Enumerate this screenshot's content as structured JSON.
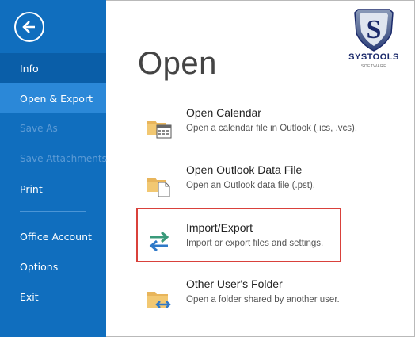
{
  "sidebar": {
    "back_icon": "back-arrow-icon",
    "items": [
      {
        "label": "Info",
        "state": "active"
      },
      {
        "label": "Open & Export",
        "state": "selected"
      },
      {
        "label": "Save As",
        "state": "disabled"
      },
      {
        "label": "Save Attachments",
        "state": "disabled"
      },
      {
        "label": "Print",
        "state": "normal"
      },
      {
        "label": "Office Account",
        "state": "normal"
      },
      {
        "label": "Options",
        "state": "normal"
      },
      {
        "label": "Exit",
        "state": "normal"
      }
    ]
  },
  "main": {
    "title": "Open",
    "options": [
      {
        "title": "Open Calendar",
        "description": "Open a calendar file in Outlook (.ics, .vcs).",
        "icon": "folder-calendar-icon"
      },
      {
        "title": "Open Outlook Data File",
        "description": "Open an Outlook data file (.pst).",
        "icon": "folder-file-icon"
      },
      {
        "title": "Import/Export",
        "description": "Import or export files and settings.",
        "icon": "import-export-arrows-icon"
      },
      {
        "title": "Other User's Folder",
        "description": "Open a folder shared by another user.",
        "icon": "folder-shared-icon"
      }
    ]
  },
  "logo": {
    "brand": "SYSTOOLS",
    "sub": "SOFTWARE",
    "icon": "systools-shield-icon"
  },
  "colors": {
    "sidebar": "#106ebe",
    "sidebar_selected": "#2b88d8",
    "highlight": "#d9413b",
    "folder": "#e8b55b"
  }
}
